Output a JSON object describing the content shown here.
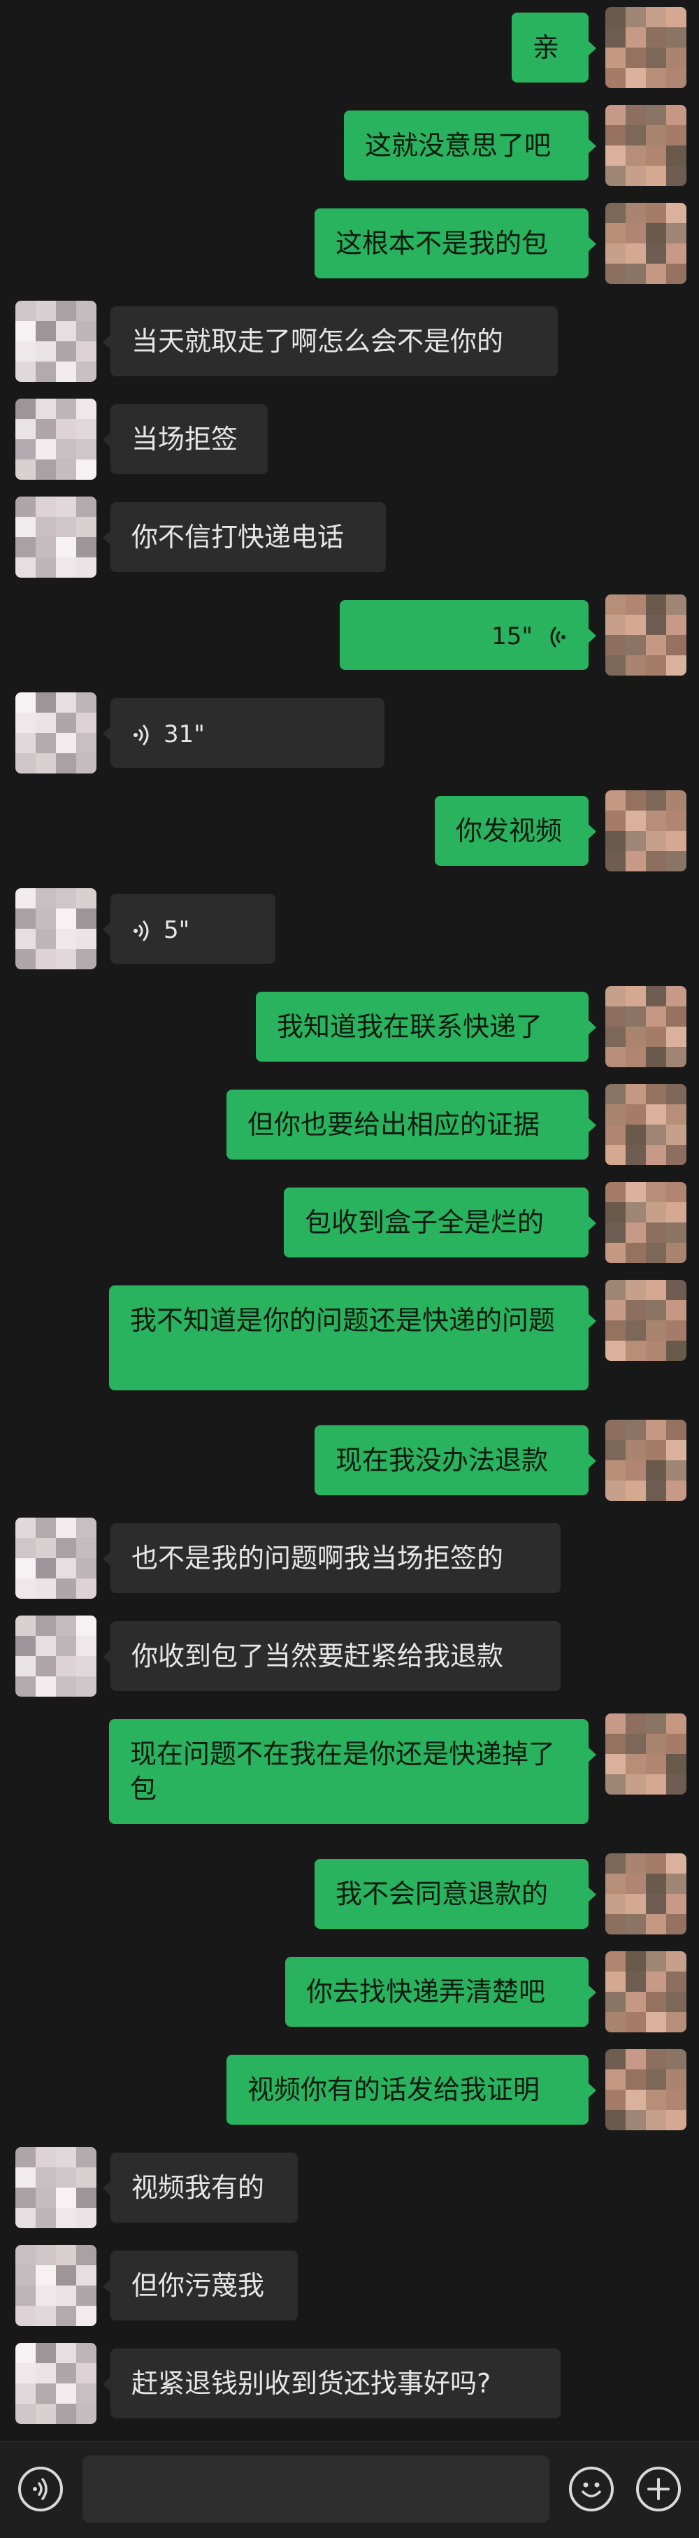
{
  "conversation": {
    "messages": [
      {
        "from": "me",
        "type": "text",
        "text": "亲"
      },
      {
        "from": "me",
        "type": "text",
        "text": "这就没意思了吧"
      },
      {
        "from": "me",
        "type": "text",
        "text": "这根本不是我的包"
      },
      {
        "from": "peer",
        "type": "text",
        "text": "当天就取走了啊怎么会不是你的"
      },
      {
        "from": "peer",
        "type": "text",
        "text": "当场拒签"
      },
      {
        "from": "peer",
        "type": "text",
        "text": "你不信打快递电话"
      },
      {
        "from": "me",
        "type": "voice",
        "duration": "15\""
      },
      {
        "from": "peer",
        "type": "voice",
        "duration": "31\""
      },
      {
        "from": "me",
        "type": "text",
        "text": "你发视频"
      },
      {
        "from": "peer",
        "type": "voice",
        "duration": "5\""
      },
      {
        "from": "me",
        "type": "text",
        "text": "我知道我在联系快递了"
      },
      {
        "from": "me",
        "type": "text",
        "text": "但你也要给出相应的证据"
      },
      {
        "from": "me",
        "type": "text",
        "text": "包收到盒子全是烂的"
      },
      {
        "from": "me",
        "type": "text",
        "text": "我不知道是你的问题还是快递的问题"
      },
      {
        "from": "me",
        "type": "text",
        "text": "现在我没办法退款"
      },
      {
        "from": "peer",
        "type": "text",
        "text": "也不是我的问题啊我当场拒签的"
      },
      {
        "from": "peer",
        "type": "text",
        "text": "你收到包了当然要赶紧给我退款"
      },
      {
        "from": "me",
        "type": "text",
        "text": "现在问题不在我在是你还是快递掉了包"
      },
      {
        "from": "me",
        "type": "text",
        "text": "我不会同意退款的"
      },
      {
        "from": "me",
        "type": "text",
        "text": "你去找快递弄清楚吧"
      },
      {
        "from": "me",
        "type": "text",
        "text": "视频你有的话发给我证明"
      },
      {
        "from": "peer",
        "type": "text",
        "text": "视频我有的"
      },
      {
        "from": "peer",
        "type": "text",
        "text": "但你污蔑我"
      },
      {
        "from": "peer",
        "type": "text",
        "text": "赶紧退钱别收到货还找事好吗?"
      }
    ]
  },
  "input_bar": {
    "voice_icon": "voice-mode-icon",
    "emoji_icon": "emoji-icon",
    "plus_icon": "plus-icon",
    "text_value": ""
  },
  "colors": {
    "background": "#181818",
    "my_bubble": "#29b35e",
    "peer_bubble": "#2c2c2c",
    "peer_text": "#e6e6e6"
  }
}
